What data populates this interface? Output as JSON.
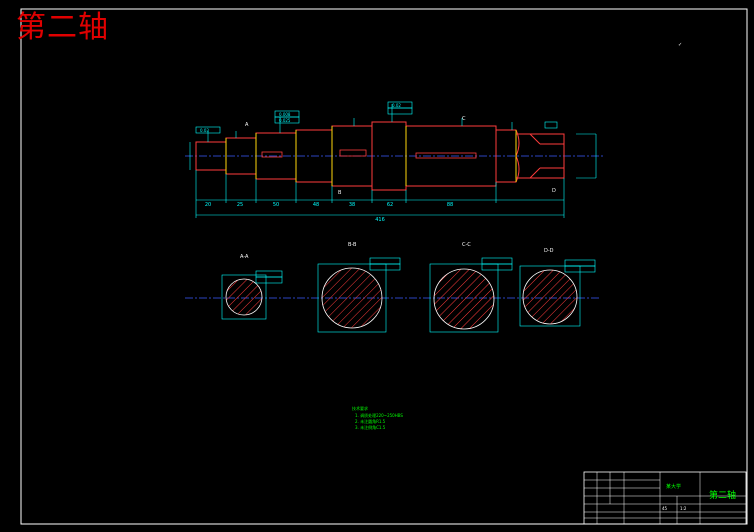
{
  "page": {
    "overlay_title": "第二轴",
    "title_block_name": "第二轴",
    "colors": {
      "background": "#000000",
      "frame": "#ffffff",
      "part_outline": "#ff3b3b",
      "dimension": "#00ffff",
      "center_line": "#3a5cff",
      "hatch": "#ff3b3b",
      "notes": "#00ff00",
      "overlay_title": "#e00000"
    }
  },
  "main_view": {
    "dimensions": [
      "20",
      "25",
      "50",
      "48",
      "38",
      "62",
      "88",
      "416"
    ],
    "tolerance_tags": [
      "0.03",
      "0.008",
      "0.025",
      "0.02"
    ],
    "section_markers": [
      "A",
      "B",
      "C",
      "D"
    ]
  },
  "sections": [
    {
      "label": "A-A"
    },
    {
      "label": "B-B"
    },
    {
      "label": "C-C"
    },
    {
      "label": "D-D"
    }
  ],
  "notes": {
    "heading": "技术要求",
    "items": [
      "1. 调质处理220~250HBS",
      "2. 未注圆角R1.5",
      "3. 未注倒角C1.5"
    ]
  },
  "title_block": {
    "material": "45",
    "scale": "1:2",
    "school": "某大学",
    "name": "第二轴"
  }
}
